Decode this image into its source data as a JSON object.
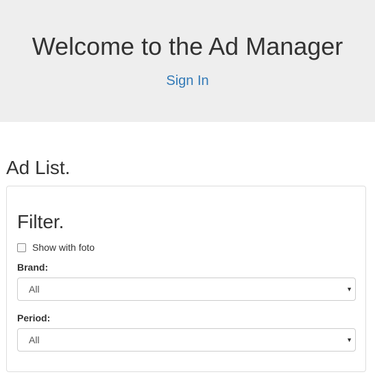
{
  "header": {
    "title": "Welcome to the Ad Manager",
    "sign_in_label": "Sign In"
  },
  "main": {
    "heading": "Ad List."
  },
  "filter": {
    "heading": "Filter.",
    "show_with_foto": {
      "label": "Show with foto",
      "checked": false
    },
    "brand": {
      "label": "Brand:",
      "selected": "All"
    },
    "period": {
      "label": "Period:",
      "selected": "All"
    }
  },
  "icons": {
    "dropdown_arrow": "chevron-down-icon"
  },
  "colors": {
    "jumbotron_bg": "#eeeeee",
    "link": "#337ab7",
    "text": "#333333"
  }
}
